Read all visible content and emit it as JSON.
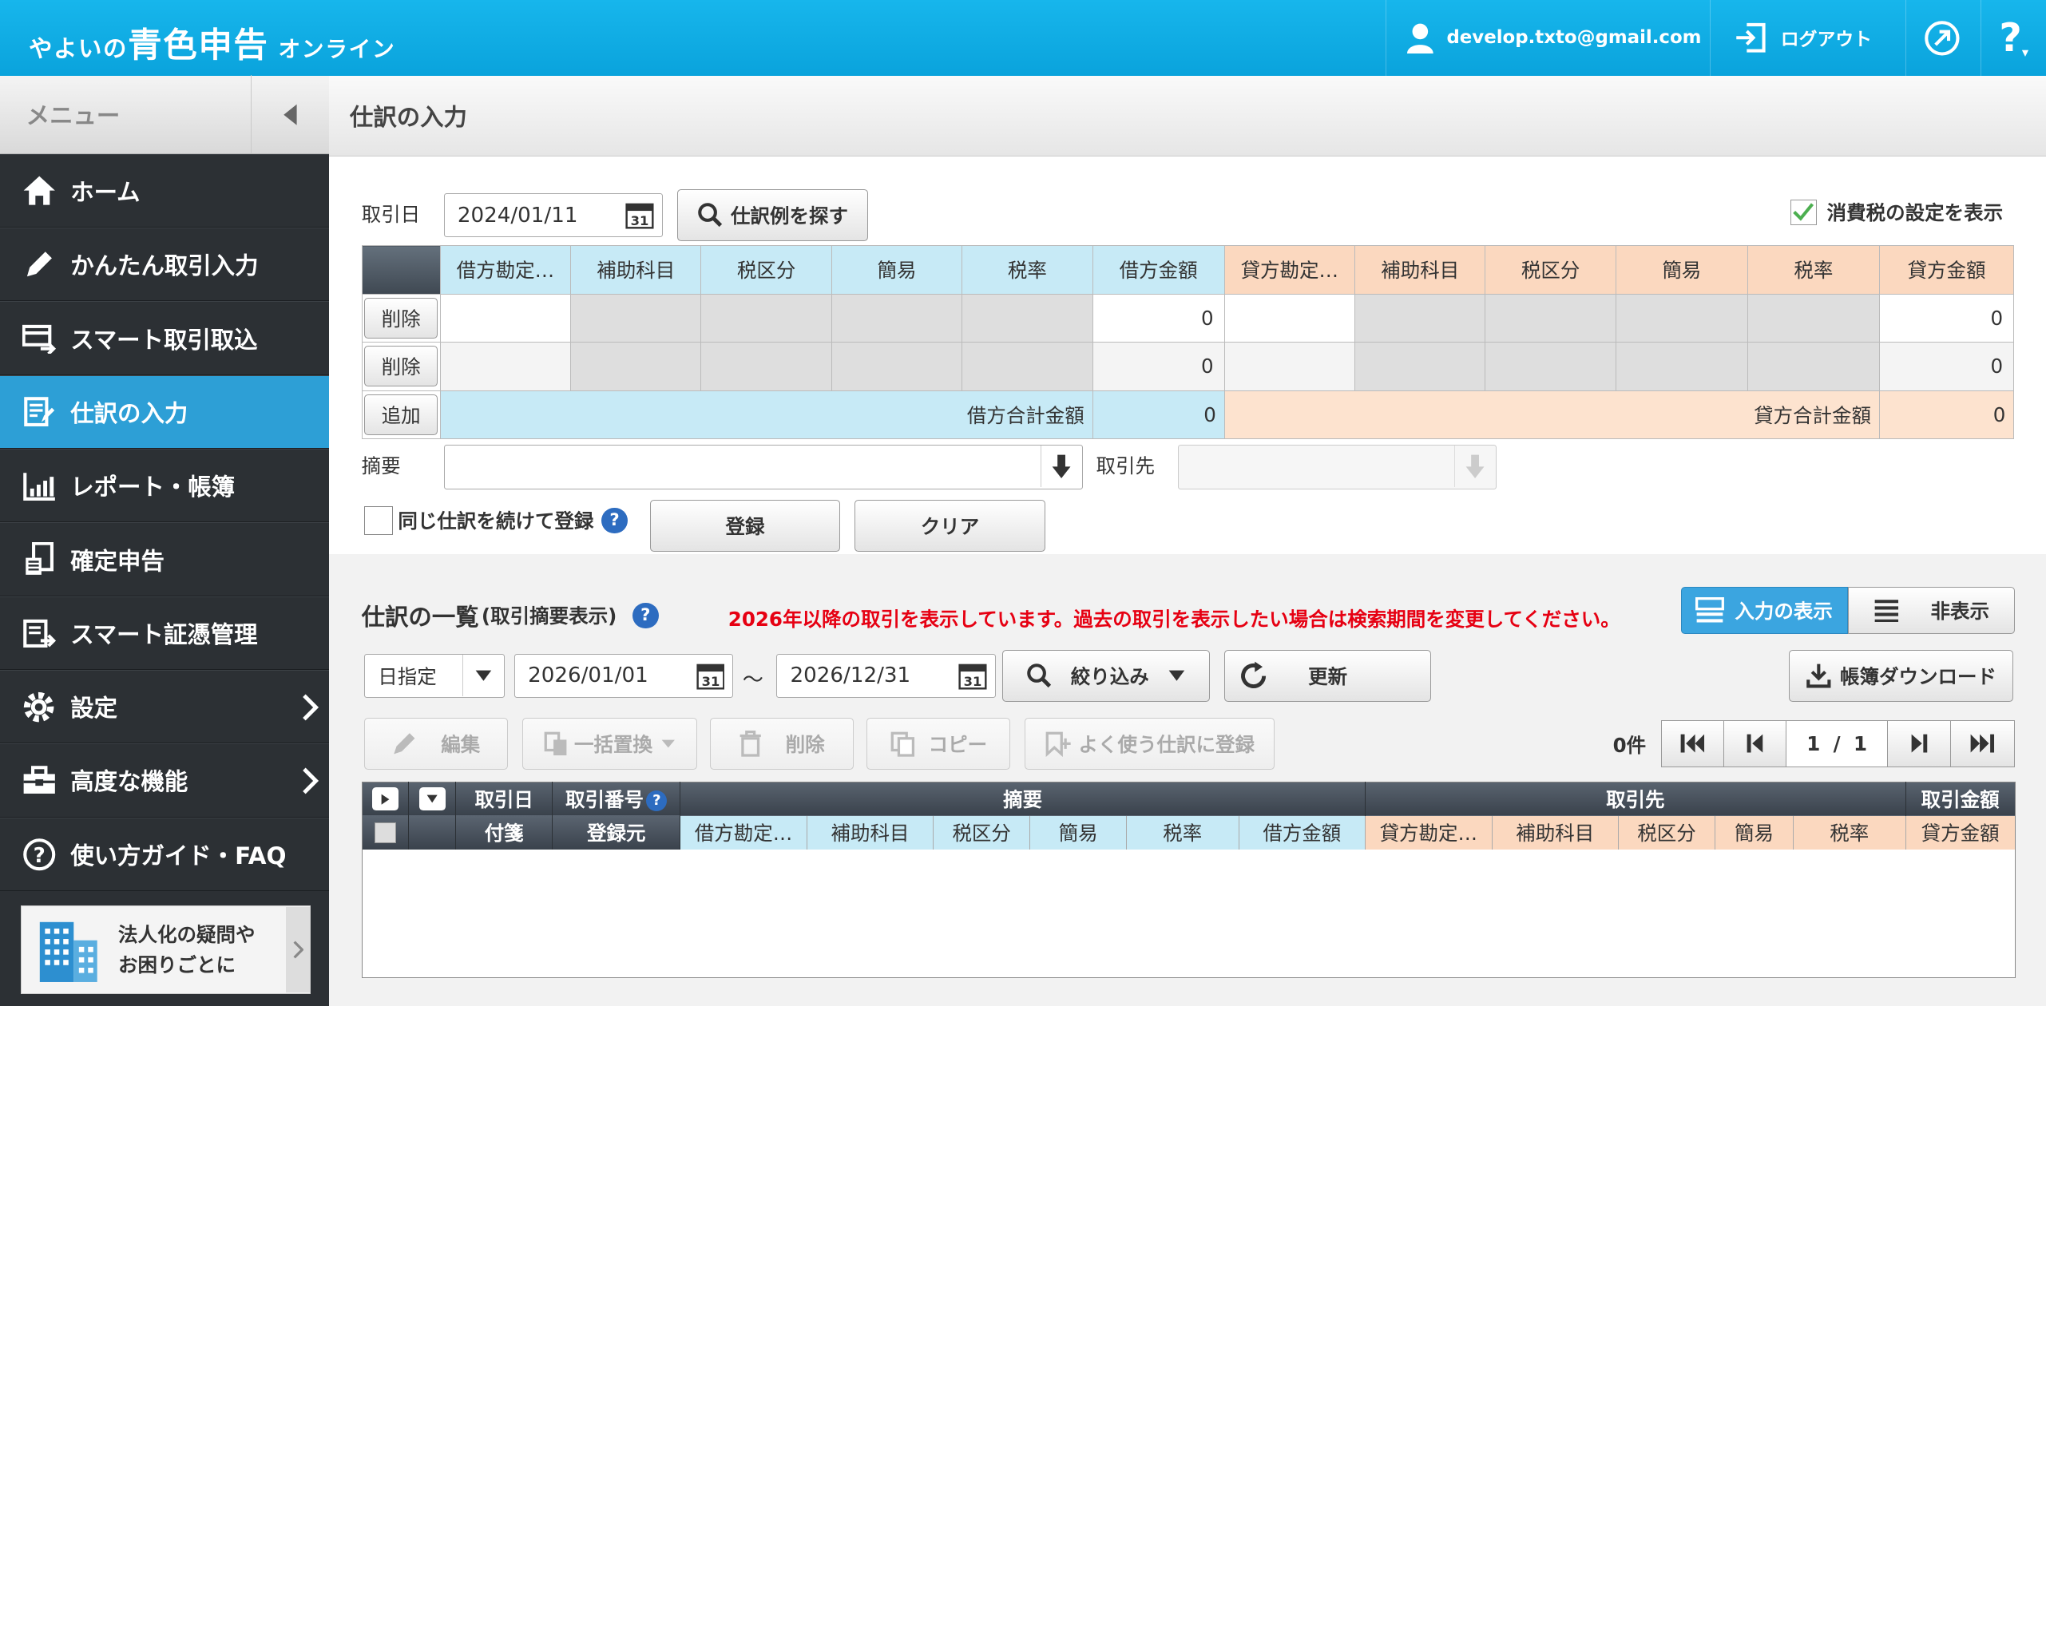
{
  "topbar": {
    "logo_pre": "やよいの",
    "logo_main": "青色申告",
    "logo_post": "オンライン",
    "user_email": "develop.txto@gmail.com",
    "logout_label": "ログアウト",
    "help_label": "?"
  },
  "sidebar": {
    "menu_label": "メニュー",
    "items": [
      {
        "label": "ホーム",
        "icon": "home-icon"
      },
      {
        "label": "かんたん取引入力",
        "icon": "pencil-icon"
      },
      {
        "label": "スマート取引取込",
        "icon": "import-icon"
      },
      {
        "label": "仕訳の入力",
        "icon": "journal-icon",
        "active": true
      },
      {
        "label": "レポート・帳簿",
        "icon": "report-icon"
      },
      {
        "label": "確定申告",
        "icon": "tax-return-icon"
      },
      {
        "label": "スマート証憑管理",
        "icon": "receipt-icon"
      },
      {
        "label": "設定",
        "icon": "gear-icon"
      },
      {
        "label": "高度な機能",
        "icon": "toolbox-icon"
      },
      {
        "label": "使い方ガイド・FAQ",
        "icon": "help-circle-icon"
      }
    ],
    "banner_line1": "法人化の疑問や",
    "banner_line2": "お困りごとに"
  },
  "page": {
    "title": "仕訳の入力"
  },
  "entry": {
    "date_label": "取引日",
    "date_value": "2024/01/11",
    "search_button": "仕訳例を探す",
    "tax_setting_label": "消費税の設定を表示",
    "tax_setting_checked": true,
    "headers": {
      "debit_account": "借方勘定…",
      "debit_sub": "補助科目",
      "debit_taxcat": "税区分",
      "debit_simple": "簡易",
      "debit_rate": "税率",
      "debit_amount": "借方金額",
      "credit_account": "貸方勘定…",
      "credit_sub": "補助科目",
      "credit_taxcat": "税区分",
      "credit_simple": "簡易",
      "credit_rate": "税率",
      "credit_amount": "貸方金額"
    },
    "rows": [
      {
        "action": "削除",
        "debit_amount": "0",
        "credit_amount": "0"
      },
      {
        "action": "削除",
        "debit_amount": "0",
        "credit_amount": "0"
      }
    ],
    "add_button": "追加",
    "debit_total_label": "借方合計金額",
    "debit_total": "0",
    "credit_total_label": "貸方合計金額",
    "credit_total": "0",
    "memo_label": "摘要",
    "partner_label": "取引先",
    "repeat_label": "同じ仕訳を続けて登録",
    "register_button": "登録",
    "clear_button": "クリア"
  },
  "list": {
    "title": "仕訳の一覧",
    "subtitle": "(取引摘要表示)",
    "notice": "2026年以降の取引を表示しています。過去の取引を表示したい場合は検索期間を変更してください。",
    "show_input_label": "入力の表示",
    "hide_label": "非表示",
    "period_select": "日指定",
    "date_from": "2026/01/01",
    "date_sep": "〜",
    "date_to": "2026/12/31",
    "filter_button": "絞り込み",
    "refresh_button": "更新",
    "download_button": "帳簿ダウンロード",
    "edit_button": "編集",
    "bulk_replace_button": "一括置換",
    "delete_button": "削除",
    "copy_button": "コピー",
    "favorite_button": "よく使う仕訳に登録",
    "count": "0件",
    "page_current": "1",
    "page_sep": "/",
    "page_total": "1",
    "headers_row1": {
      "date": "取引日",
      "number": "取引番号",
      "memo": "摘要",
      "partner": "取引先",
      "amount": "取引金額"
    },
    "headers_row2": {
      "tag": "付箋",
      "source": "登録元",
      "debit_account": "借方勘定…",
      "debit_sub": "補助科目",
      "debit_taxcat": "税区分",
      "debit_simple": "簡易",
      "debit_rate": "税率",
      "debit_amount": "借方金額",
      "credit_account": "貸方勘定…",
      "credit_sub": "補助科目",
      "credit_taxcat": "税区分",
      "credit_simple": "簡易",
      "credit_rate": "税率",
      "credit_amount": "貸方金額"
    }
  },
  "colors": {
    "topbar": "#0aa3dc",
    "sidebar": "#2c3034",
    "active": "#2d9fd6",
    "debit": "#c7eaf6",
    "credit": "#fbd8bf",
    "notice": "#e60012"
  }
}
